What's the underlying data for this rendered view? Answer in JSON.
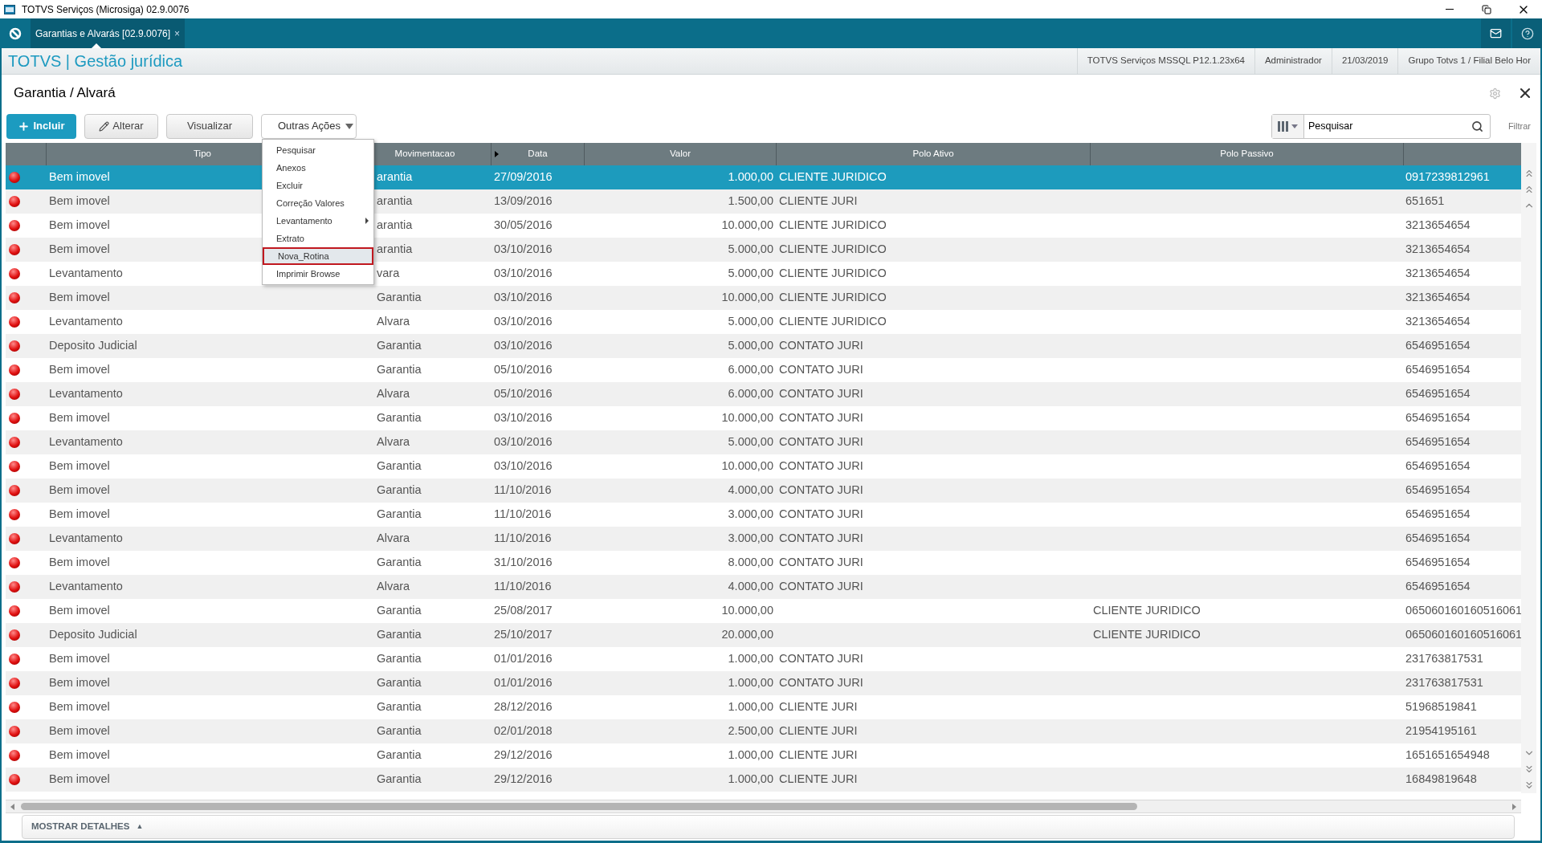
{
  "window": {
    "title": "TOTVS Serviços (Microsiga) 02.9.0076"
  },
  "app_tabs": [
    {
      "label": "Garantias e Alvarás [02.9.0076]",
      "close": "×",
      "selected": true
    }
  ],
  "header": {
    "brand": "TOTVS | Gestão jurídica",
    "info": [
      "TOTVS Serviços MSSQL P12.1.23x64",
      "Administrador",
      "21/03/2019",
      "Grupo Totvs 1 / Filial Belo Hor"
    ]
  },
  "page": {
    "title": "Garantia / Alvará"
  },
  "toolbar": {
    "buttons": [
      {
        "kind": "primary",
        "label": "Incluir"
      },
      {
        "kind": "edit",
        "label": "Alterar"
      },
      {
        "kind": "plain",
        "label": "Visualizar"
      },
      {
        "kind": "dropdown",
        "label": "Outras Ações"
      }
    ],
    "search": {
      "value": "Pesquisar"
    },
    "filter": "Filtrar"
  },
  "menu": {
    "items": [
      {
        "label": "Pesquisar",
        "selected": false,
        "submenu": false
      },
      {
        "label": "Anexos",
        "selected": false,
        "submenu": false
      },
      {
        "label": "Excluir",
        "selected": false,
        "submenu": false
      },
      {
        "label": "Correção Valores",
        "selected": false,
        "submenu": false
      },
      {
        "label": "Levantamento",
        "selected": false,
        "submenu": true
      },
      {
        "label": "Extrato",
        "selected": false,
        "submenu": false
      },
      {
        "label": "Nova_Rotina",
        "selected": true,
        "submenu": false
      },
      {
        "label": "Imprimir Browse",
        "selected": false,
        "submenu": false
      }
    ]
  },
  "table": {
    "columns": [
      "Tipo",
      "Movimentacao",
      "Data",
      "Valor",
      "Polo Ativo",
      "Polo Passivo"
    ],
    "rows": [
      {
        "tipo": "Bem imovel",
        "movimentacao": "arantia",
        "data": "27/09/2016",
        "valor": "1.000,00",
        "polo_ativo": "CLIENTE JURIDICO",
        "column_8": "0917239812961",
        "selected": true
      },
      {
        "tipo": "Bem imovel",
        "movimentacao": "arantia",
        "data": "13/09/2016",
        "valor": "1.500,00",
        "polo_ativo": "CLIENTE JURI",
        "column_8": "651651",
        "selected": false
      },
      {
        "tipo": "Bem imovel",
        "movimentacao": "arantia",
        "data": "30/05/2016",
        "valor": "10.000,00",
        "polo_ativo": "CLIENTE JURIDICO",
        "column_8": "3213654654",
        "selected": false
      },
      {
        "tipo": "Bem imovel",
        "movimentacao": "arantia",
        "data": "03/10/2016",
        "valor": "5.000,00",
        "polo_ativo": "CLIENTE JURIDICO",
        "column_8": "3213654654",
        "selected": false
      },
      {
        "tipo": "Levantamento",
        "movimentacao": "vara",
        "data": "03/10/2016",
        "valor": "5.000,00",
        "polo_ativo": "CLIENTE JURIDICO",
        "column_8": "3213654654",
        "selected": false
      },
      {
        "tipo": "Bem imovel",
        "movimentacao": "Garantia",
        "data": "03/10/2016",
        "valor": "10.000,00",
        "polo_ativo": "CLIENTE JURIDICO",
        "column_8": "3213654654",
        "selected": false
      },
      {
        "tipo": "Levantamento",
        "movimentacao": "Alvara",
        "data": "03/10/2016",
        "valor": "5.000,00",
        "polo_ativo": "CLIENTE JURIDICO",
        "column_8": "3213654654",
        "selected": false
      },
      {
        "tipo": "Deposito Judicial",
        "movimentacao": "Garantia",
        "data": "03/10/2016",
        "valor": "5.000,00",
        "polo_ativo": "CONTATO JURI",
        "column_8": "6546951654",
        "selected": false
      },
      {
        "tipo": "Bem imovel",
        "movimentacao": "Garantia",
        "data": "05/10/2016",
        "valor": "6.000,00",
        "polo_ativo": "CONTATO JURI",
        "column_8": "6546951654",
        "selected": false
      },
      {
        "tipo": "Levantamento",
        "movimentacao": "Alvara",
        "data": "05/10/2016",
        "valor": "6.000,00",
        "polo_ativo": "CONTATO JURI",
        "column_8": "6546951654",
        "selected": false
      },
      {
        "tipo": "Bem imovel",
        "movimentacao": "Garantia",
        "data": "03/10/2016",
        "valor": "10.000,00",
        "polo_ativo": "CONTATO JURI",
        "column_8": "6546951654",
        "selected": false
      },
      {
        "tipo": "Levantamento",
        "movimentacao": "Alvara",
        "data": "03/10/2016",
        "valor": "5.000,00",
        "polo_ativo": "CONTATO JURI",
        "column_8": "6546951654",
        "selected": false
      },
      {
        "tipo": "Bem imovel",
        "movimentacao": "Garantia",
        "data": "03/10/2016",
        "valor": "10.000,00",
        "polo_ativo": "CONTATO JURI",
        "column_8": "6546951654",
        "selected": false
      },
      {
        "tipo": "Bem imovel",
        "movimentacao": "Garantia",
        "data": "11/10/2016",
        "valor": "4.000,00",
        "polo_ativo": "CONTATO JURI",
        "column_8": "6546951654",
        "selected": false
      },
      {
        "tipo": "Bem imovel",
        "movimentacao": "Garantia",
        "data": "11/10/2016",
        "valor": "3.000,00",
        "polo_ativo": "CONTATO JURI",
        "column_8": "6546951654",
        "selected": false
      },
      {
        "tipo": "Levantamento",
        "movimentacao": "Alvara",
        "data": "11/10/2016",
        "valor": "3.000,00",
        "polo_ativo": "CONTATO JURI",
        "column_8": "6546951654",
        "selected": false
      },
      {
        "tipo": "Bem imovel",
        "movimentacao": "Garantia",
        "data": "31/10/2016",
        "valor": "8.000,00",
        "polo_ativo": "CONTATO JURI",
        "column_8": "6546951654",
        "selected": false
      },
      {
        "tipo": "Levantamento",
        "movimentacao": "Alvara",
        "data": "11/10/2016",
        "valor": "4.000,00",
        "polo_ativo": "CONTATO JURI",
        "column_8": "6546951654",
        "selected": false
      },
      {
        "tipo": "Bem imovel",
        "movimentacao": "Garantia",
        "data": "25/08/2017",
        "valor": "10.000,00",
        "polo_passivo": "CLIENTE JURIDICO",
        "column_8": "065060160160516061",
        "selected": false
      },
      {
        "tipo": "Deposito Judicial",
        "movimentacao": "Garantia",
        "data": "25/10/2017",
        "valor": "20.000,00",
        "polo_passivo": "CLIENTE JURIDICO",
        "column_8": "065060160160516061",
        "selected": false
      },
      {
        "tipo": "Bem imovel",
        "movimentacao": "Garantia",
        "data": "01/01/2016",
        "valor": "1.000,00",
        "polo_ativo": "CONTATO JURI",
        "column_8": "231763817531",
        "selected": false
      },
      {
        "tipo": "Bem imovel",
        "movimentacao": "Garantia",
        "data": "01/01/2016",
        "valor": "1.000,00",
        "polo_ativo": "CONTATO JURI",
        "column_8": "231763817531",
        "selected": false
      },
      {
        "tipo": "Bem imovel",
        "movimentacao": "Garantia",
        "data": "28/12/2016",
        "valor": "1.000,00",
        "polo_ativo": "CLIENTE JURI",
        "column_8": "51968519841",
        "selected": false
      },
      {
        "tipo": "Bem imovel",
        "movimentacao": "Garantia",
        "data": "02/01/2018",
        "valor": "2.500,00",
        "polo_ativo": "CLIENTE JURI",
        "column_8": "21954195161",
        "selected": false
      },
      {
        "tipo": "Bem imovel",
        "movimentacao": "Garantia",
        "data": "29/12/2016",
        "valor": "1.000,00",
        "polo_ativo": "CLIENTE JURI",
        "column_8": "1651651654948",
        "selected": false
      },
      {
        "tipo": "Bem imovel",
        "movimentacao": "Garantia",
        "data": "29/12/2016",
        "valor": "1.000,00",
        "polo_ativo": "CLIENTE JURI",
        "column_8": "16849819648",
        "selected": false
      }
    ]
  },
  "details_toggle": {
    "label": "MOSTRAR DETALHES",
    "icon": "▲"
  }
}
